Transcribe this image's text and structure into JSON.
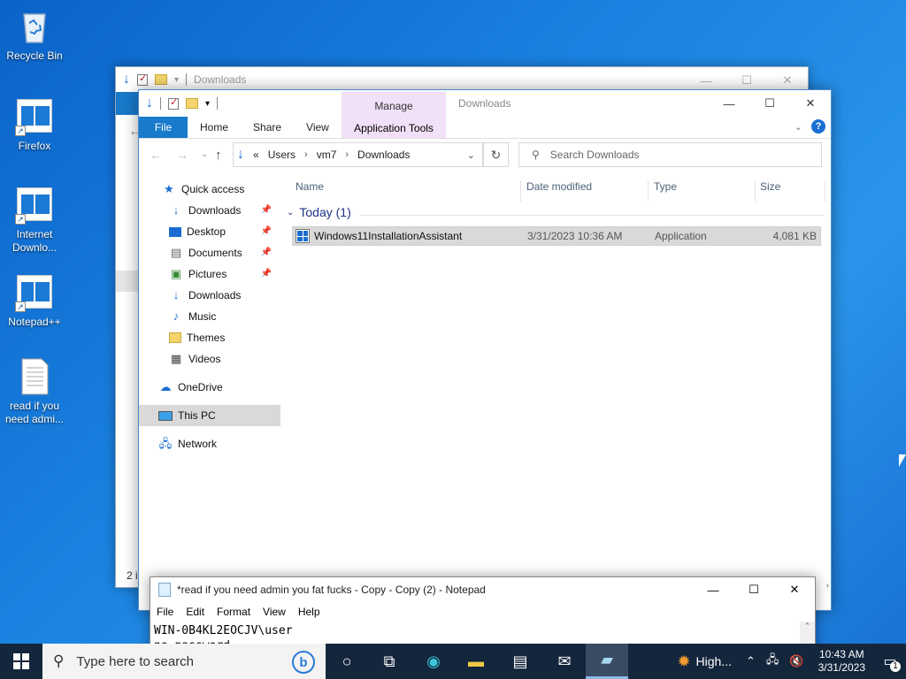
{
  "desktop": {
    "icons": [
      {
        "label": "Recycle Bin"
      },
      {
        "label": "Firefox"
      },
      {
        "label": "Internet Downlo..."
      },
      {
        "label": "Notepad++"
      },
      {
        "label": "read if you need admi..."
      }
    ]
  },
  "back_window": {
    "title": "Downloads",
    "status": "2 i"
  },
  "explorer": {
    "title": "Downloads",
    "context_tab_group": "Manage",
    "context_tab": "Application Tools",
    "ribbon_tabs": [
      "File",
      "Home",
      "Share",
      "View"
    ],
    "breadcrumb": [
      "Users",
      "vm7",
      "Downloads"
    ],
    "breadcrumb_prefix": "«",
    "search_placeholder": "Search Downloads",
    "nav": {
      "quick_access": "Quick access",
      "items": [
        {
          "label": "Downloads",
          "icon": "download-icon",
          "pinned": true
        },
        {
          "label": "Desktop",
          "icon": "desktop-icon",
          "pinned": true
        },
        {
          "label": "Documents",
          "icon": "documents-icon",
          "pinned": true
        },
        {
          "label": "Pictures",
          "icon": "pictures-icon",
          "pinned": true
        },
        {
          "label": "Downloads",
          "icon": "download-icon",
          "pinned": false
        },
        {
          "label": "Music",
          "icon": "music-icon",
          "pinned": false
        },
        {
          "label": "Themes",
          "icon": "folder-icon",
          "pinned": false
        },
        {
          "label": "Videos",
          "icon": "videos-icon",
          "pinned": false
        }
      ],
      "onedrive": "OneDrive",
      "this_pc": "This PC",
      "network": "Network"
    },
    "columns": {
      "name": "Name",
      "date": "Date modified",
      "type": "Type",
      "size": "Size"
    },
    "group": {
      "label": "Today (1)"
    },
    "files": [
      {
        "name": "Windows11InstallationAssistant",
        "date": "3/31/2023 10:36 AM",
        "type": "Application",
        "size": "4,081 KB"
      }
    ]
  },
  "notepad": {
    "title": "*read if you need admin you fat fucks - Copy - Copy (2) - Notepad",
    "menu": [
      "File",
      "Edit",
      "Format",
      "View",
      "Help"
    ],
    "line1": "WIN-0B4KL2EOCJV\\user",
    "line2": "no password"
  },
  "taskbar": {
    "search_placeholder": "Type here to search",
    "weather": "High...",
    "time": "10:43 AM",
    "date": "3/31/2023",
    "notifications": "1"
  },
  "colors": {
    "accent": "#1979ca",
    "manage_tab": "#f1e0f7",
    "taskbar": "#14263c"
  }
}
